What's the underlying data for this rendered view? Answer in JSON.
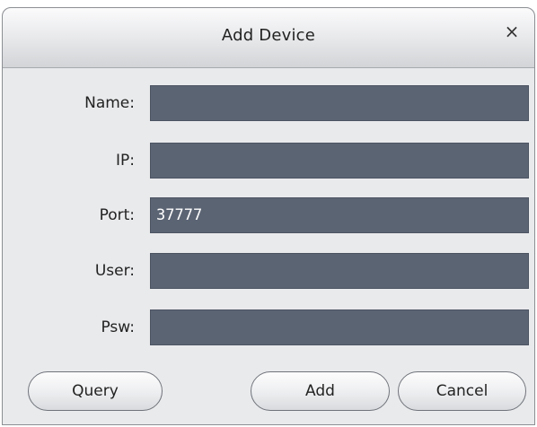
{
  "dialog": {
    "title": "Add Device",
    "close_icon": "×"
  },
  "fields": {
    "name": {
      "label": "Name:",
      "value": ""
    },
    "ip": {
      "label": "IP:",
      "value": ""
    },
    "port": {
      "label": "Port:",
      "value": "37777"
    },
    "user": {
      "label": "User:",
      "value": ""
    },
    "psw": {
      "label": "Psw:",
      "value": ""
    }
  },
  "buttons": {
    "query": "Query",
    "add": "Add",
    "cancel": "Cancel"
  },
  "colors": {
    "field_background": "#5b6473",
    "dialog_background": "#e9eaec"
  }
}
